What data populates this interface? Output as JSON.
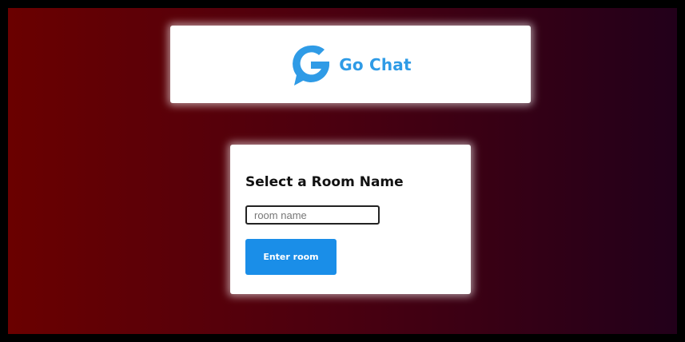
{
  "header": {
    "logo_icon": "go-chat-logo-icon",
    "brand_name": "Go Chat",
    "brand_color": "#2f9be6"
  },
  "room_form": {
    "title": "Select a Room Name",
    "input_placeholder": "room name",
    "input_value": "",
    "submit_label": "Enter room",
    "button_color": "#1a8ee8"
  },
  "background": {
    "gradient_start": "#6a0000",
    "gradient_end": "#22001a"
  }
}
